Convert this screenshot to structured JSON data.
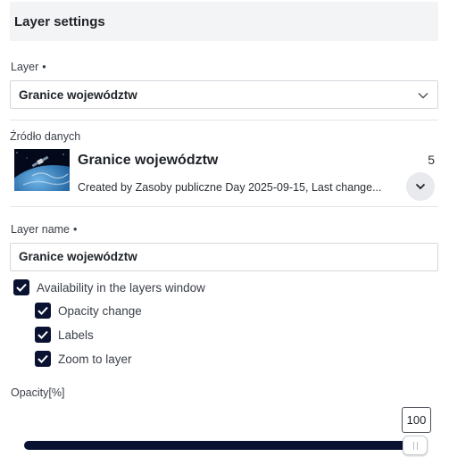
{
  "header": {
    "title": "Layer settings"
  },
  "layer_field": {
    "label": "Layer",
    "required_mark": "•",
    "selected_value": "Granice województw"
  },
  "data_source": {
    "label": "Źródło danych",
    "title": "Granice województw",
    "count": "5",
    "description": "Created by Zasoby publiczne Day 2025-09-15, Last change..."
  },
  "layer_name_field": {
    "label": "Layer name",
    "required_mark": "•",
    "value": "Granice województw"
  },
  "checkboxes": [
    {
      "label": "Availability in the layers window",
      "checked": true
    },
    {
      "label": "Opacity change",
      "checked": true
    },
    {
      "label": "Labels",
      "checked": true
    },
    {
      "label": "Zoom to layer",
      "checked": true
    }
  ],
  "opacity": {
    "label": "Opacity[%]",
    "value": 100,
    "display": "100",
    "min": 0,
    "max": 100
  },
  "colors": {
    "accent": "#0a1232",
    "border": "#d4d7dc",
    "header_bg": "#f3f4f6"
  }
}
